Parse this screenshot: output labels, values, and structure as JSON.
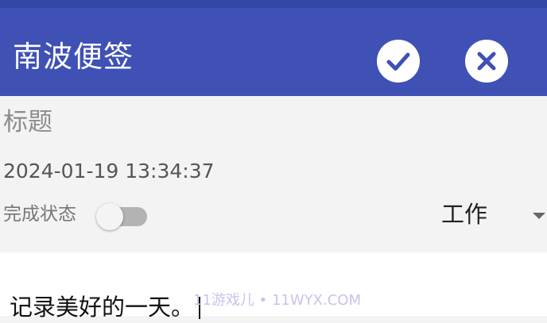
{
  "app_bar": {
    "title": "南波便签",
    "confirm_icon": "check-icon",
    "close_icon": "close-icon",
    "color": "#3f51b5"
  },
  "form": {
    "title_placeholder": "标题",
    "title_value": "",
    "datetime": "2024-01-19 13:34:37",
    "done_label": "完成状态",
    "done_state": false,
    "category": "工作"
  },
  "editor": {
    "content": "记录美好的一天。"
  },
  "watermark": "11游戏儿 • 11WYX.COM"
}
